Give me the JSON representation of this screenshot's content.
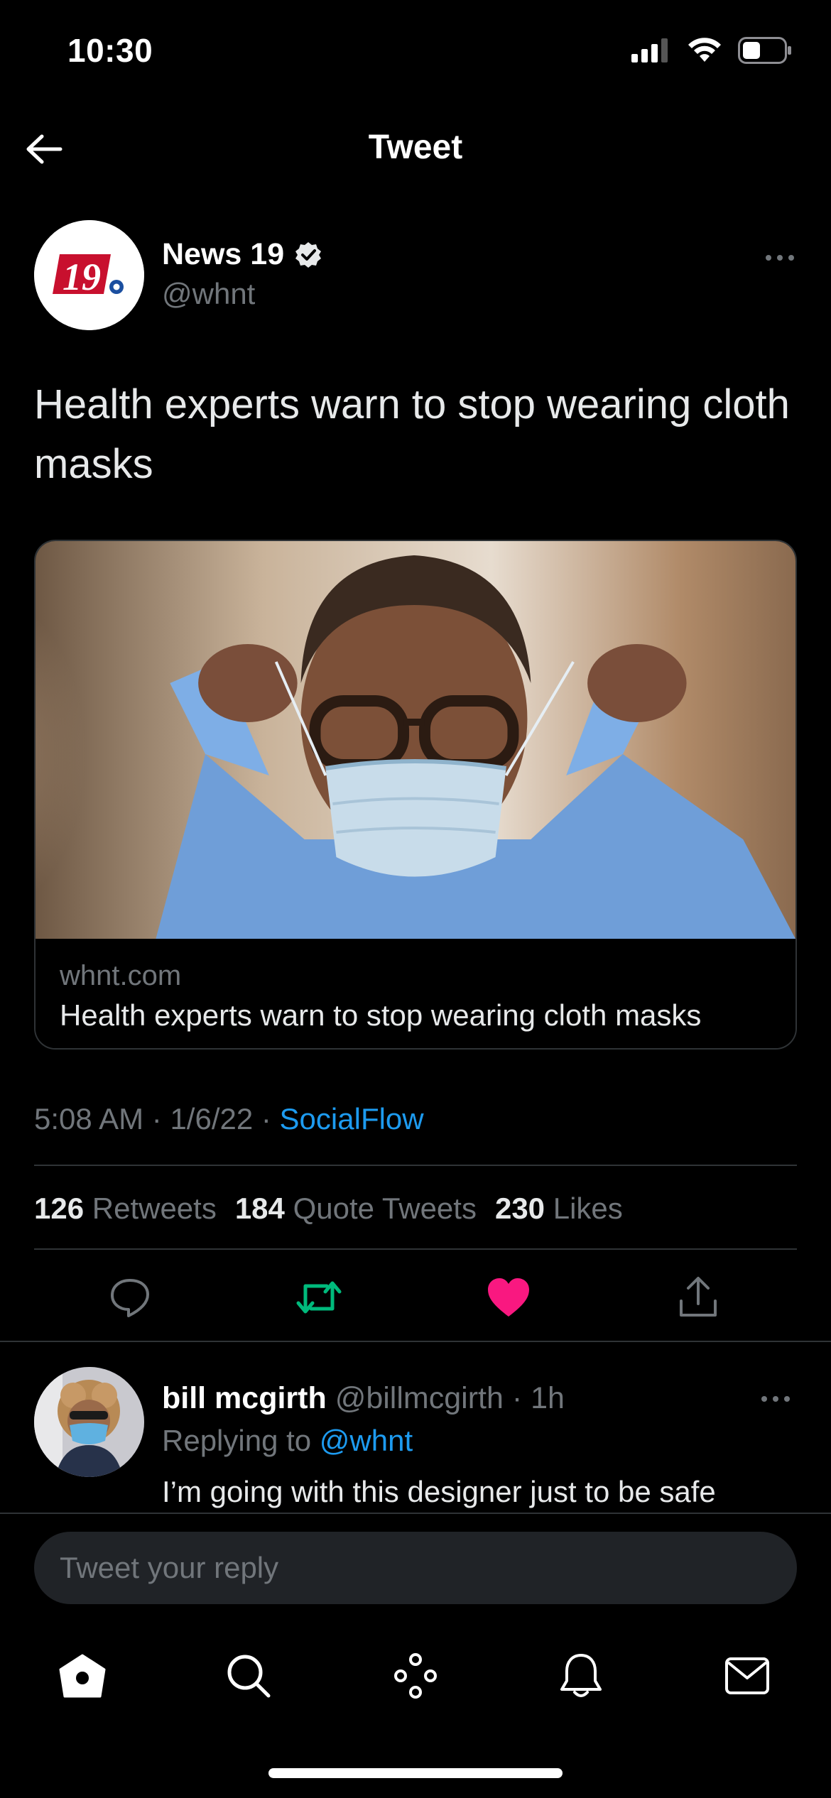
{
  "status_bar": {
    "time": "10:30"
  },
  "header": {
    "title": "Tweet"
  },
  "tweet": {
    "author_name": "News 19",
    "author_handle": "@whnt",
    "avatar_text": "19",
    "text": "Health experts warn to stop wearing cloth masks",
    "card": {
      "domain": "whnt.com",
      "title": "Health experts warn to stop wearing cloth masks"
    },
    "time": "5:08 AM",
    "date": "1/6/22",
    "source": "SocialFlow",
    "retweets_count": "126",
    "retweets_label": "Retweets",
    "quotes_count": "184",
    "quotes_label": "Quote Tweets",
    "likes_count": "230",
    "likes_label": "Likes"
  },
  "reply": {
    "name": "bill mcgirth",
    "handle": "@billmcgirth",
    "time": "1h",
    "replying_to_label": "Replying to",
    "replying_to_handle": "@whnt",
    "text": "I’m going with this designer just to be safe"
  },
  "composer": {
    "placeholder": "Tweet your reply"
  },
  "colors": {
    "accent": "#1d9bf0",
    "retweet": "#00ba7c",
    "like": "#f91880",
    "muted": "#71767b"
  },
  "icons": [
    "back-arrow-icon",
    "verified-badge-icon",
    "reply-icon",
    "retweet-icon",
    "heart-icon",
    "share-icon",
    "home-icon",
    "search-icon",
    "spaces-icon",
    "notifications-icon",
    "messages-icon"
  ]
}
